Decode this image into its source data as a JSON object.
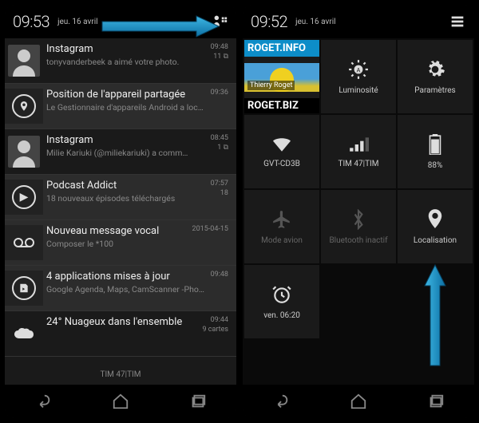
{
  "left": {
    "clock": "09:53",
    "date": "jeu. 16 avril",
    "notifications": [
      {
        "app": "Instagram",
        "sub": "tonyvanderbeek a aimé votre photo.",
        "time": "09:48",
        "extra": "11 ⧉",
        "icon": "avatar",
        "sel": false
      },
      {
        "app": "Position de l'appareil partagée",
        "sub": "Le Gestionnaire d'appareils Android a locali…",
        "time": "09:36",
        "extra": "",
        "icon": "pin",
        "sel": true
      },
      {
        "app": "Instagram",
        "sub": "Milie Kariuki (@miliekariuki) a comm…",
        "time": "08:45",
        "extra": "1 ⧉",
        "icon": "avatar",
        "sel": false
      },
      {
        "app": "Podcast Addict",
        "sub": "18 nouveaux épisodes téléchargés",
        "time": "07:57",
        "extra": "18",
        "icon": "podcast",
        "sel": true
      },
      {
        "app": "Nouveau message vocal",
        "sub": "Composer le *100",
        "time": "2015-04-15",
        "extra": "",
        "icon": "voicemail",
        "sel": true
      },
      {
        "app": "4 applications mises à jour",
        "sub": "Google Agenda, Maps, CamScanner -Phon…",
        "time": "09:48",
        "extra": "",
        "icon": "play",
        "sel": true
      },
      {
        "app": "24° Nuageux dans l'ensemble",
        "sub": "",
        "time": "09:44",
        "extra": "9 cartes",
        "icon": "cloud",
        "sel": false
      }
    ],
    "footer": "TIM 47|TIM"
  },
  "right": {
    "clock": "09:52",
    "date": "jeu. 16 avril",
    "profile": {
      "top": "ROGET.INFO",
      "name": "Thierry Roget",
      "bot": "ROGET.BIZ"
    },
    "tiles": [
      {
        "label": "Luminosité",
        "icon": "brightness",
        "off": false
      },
      {
        "label": "Paramètres",
        "icon": "gear",
        "off": false
      },
      {
        "label": "GVT-CD3B",
        "icon": "wifi",
        "off": false
      },
      {
        "label": "TIM 47|TIM",
        "icon": "signal",
        "off": false
      },
      {
        "label": "88%",
        "icon": "battery",
        "off": false
      },
      {
        "label": "Mode avion",
        "icon": "airplane",
        "off": true
      },
      {
        "label": "Bluetooth inactif",
        "icon": "bluetooth",
        "off": true
      },
      {
        "label": "Localisation",
        "icon": "location",
        "off": false
      },
      {
        "label": "ven. 06:20",
        "icon": "alarm",
        "off": false
      }
    ]
  }
}
